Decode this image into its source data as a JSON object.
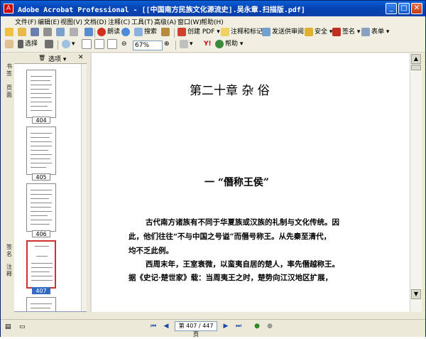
{
  "window": {
    "title": "Adobe Acrobat Professional - [[中国南方民族文化源流史].吴永章.扫描版.pdf]"
  },
  "menu": [
    "文件(F)",
    "编辑(E)",
    "视图(V)",
    "文档(D)",
    "注释(C)",
    "工具(T)",
    "高级(A)",
    "窗口(W)",
    "帮助(H)"
  ],
  "toolbar1": {
    "search_label": "搜索",
    "create_pdf_label": "创建 PDF",
    "comment_label": "注释和标记",
    "review_label": "发送供审阅",
    "security_label": "安全",
    "sign_label": "签名",
    "form_label": "表单",
    "read_label": "朗读"
  },
  "toolbar2": {
    "select_label": "选择",
    "zoom_value": "67%",
    "help_label": "帮助"
  },
  "sidebar": {
    "tabs": [
      "书签",
      "页面",
      "签名",
      "注释"
    ],
    "options_label": "选项",
    "thumbnails": [
      {
        "label": "404",
        "selected": false
      },
      {
        "label": "405",
        "selected": false
      },
      {
        "label": "406",
        "selected": false
      },
      {
        "label": "407",
        "selected": true
      }
    ]
  },
  "document": {
    "chapter_title": "第二十章  杂    俗",
    "section_title": "一  “僭称王侯”",
    "paragraph_lines": [
      "古代南方诸族有不同于华夏族或汉族的礼制与文化传统。因",
      "此，他们往往“不与中国之号谥”而僭号称王。从先秦至清代，",
      "均不乏此例。",
      "西周末年，王室衰微，以蛮夷自居的楚人，率先僭越称王。",
      "据《史记·楚世家》载：当周夷王之时，楚势向江汉地区扩展，"
    ]
  },
  "status": {
    "page_indicator": "第 407 / 447 页"
  }
}
